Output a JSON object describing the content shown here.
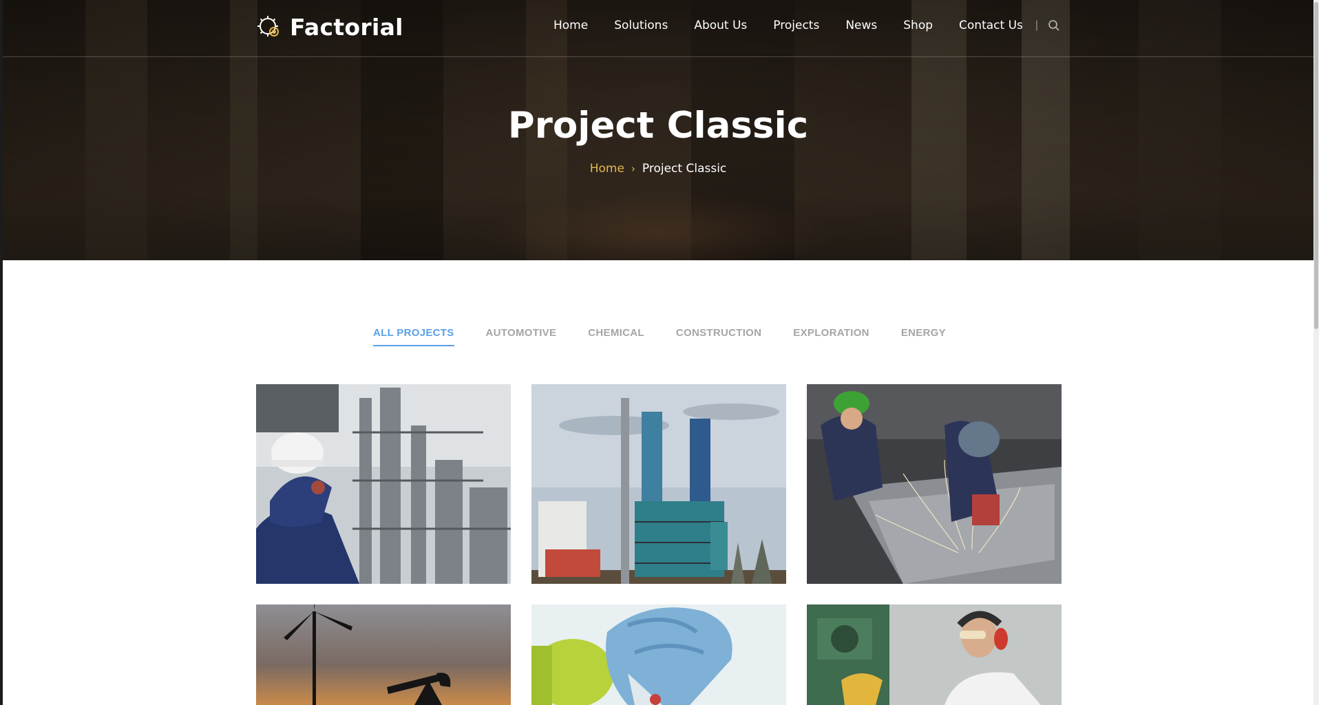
{
  "site": {
    "brand": "Factorial"
  },
  "nav": {
    "items": [
      "Home",
      "Solutions",
      "About Us",
      "Projects",
      "News",
      "Shop",
      "Contact Us"
    ],
    "separator": "|",
    "search_icon": "search-icon"
  },
  "hero": {
    "title": "Project Classic",
    "breadcrumb": {
      "home": "Home",
      "separator": "›",
      "current": "Project Classic"
    }
  },
  "filters": {
    "tabs": [
      "ALL PROJECTS",
      "AUTOMOTIVE",
      "CHEMICAL",
      "CONSTRUCTION",
      "EXPLORATION",
      "ENERGY"
    ],
    "active": "ALL PROJECTS"
  },
  "projects": [
    {
      "image": "engineer-with-hardhat-at-refinery"
    },
    {
      "image": "chemical-plant-towers"
    },
    {
      "image": "welders-in-workshop"
    },
    {
      "image": "wind-turbine-and-oil-pump-at-sunset"
    },
    {
      "image": "gloved-hand-with-lab-flask"
    },
    {
      "image": "worker-at-drill-press"
    }
  ],
  "colors": {
    "accent_gold": "#e7b84a",
    "filter_active": "#5aa0e8",
    "filter_inactive": "#a5a5a5"
  }
}
